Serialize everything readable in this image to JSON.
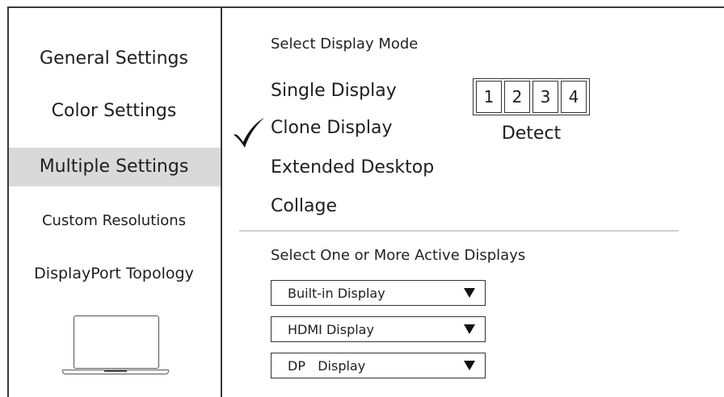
{
  "sidebar": {
    "items": [
      {
        "label": "General Settings",
        "active": false
      },
      {
        "label": "Color Settings",
        "active": false
      },
      {
        "label": "Multiple Settings",
        "active": true
      },
      {
        "label": "Custom Resolutions",
        "active": false
      },
      {
        "label": "DisplayPort Topology",
        "active": false
      }
    ],
    "device_icon": "laptop-icon"
  },
  "display_mode": {
    "heading": "Select Display Mode",
    "options": [
      {
        "label": "Single Display",
        "selected": false
      },
      {
        "label": "Clone Display",
        "selected": true
      },
      {
        "label": "Extended Desktop",
        "selected": false
      },
      {
        "label": "Collage",
        "selected": false
      }
    ],
    "selected_indicator": "check-icon"
  },
  "detect": {
    "numbers": [
      "1",
      "2",
      "3",
      "4"
    ],
    "label": "Detect"
  },
  "active_displays": {
    "heading": "Select One or More Active Displays",
    "dropdowns": [
      {
        "value": "Built-in Display"
      },
      {
        "value": "HDMI Display"
      },
      {
        "value": "DP   Display"
      }
    ]
  },
  "colors": {
    "active_item_bg": "#d9d9d9",
    "border": "#3a3a3a",
    "separator": "#cfcfcf"
  }
}
